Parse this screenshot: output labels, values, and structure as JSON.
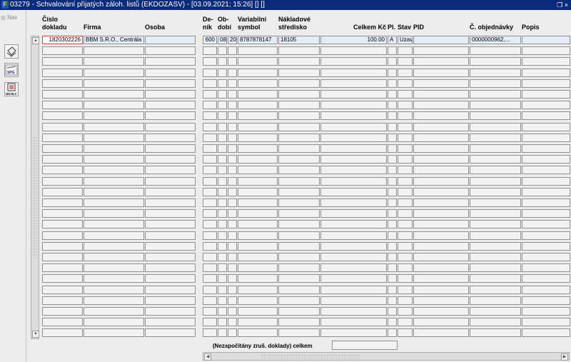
{
  "window": {
    "app_icon": "oracle-forms-icon",
    "title": "03279 - Schvalování přijatých záloh. listů (EKDOZASV) - [03.09.2021; 15:26] [] []",
    "restore_glyph": "❐",
    "close_glyph": "×"
  },
  "nav": {
    "label": "Nav"
  },
  "toolbar": {
    "buttons": [
      {
        "name": "print-icon",
        "label": ""
      },
      {
        "name": "spg-icon",
        "label": "SPG"
      },
      {
        "name": "ukoly-icon",
        "label": "ÚKOLY"
      }
    ]
  },
  "table": {
    "columns": [
      {
        "key": "doklad",
        "label1": "Číslo",
        "label2": "dokladu"
      },
      {
        "key": "firma",
        "label1": "",
        "label2": "Firma"
      },
      {
        "key": "osoba",
        "label1": "",
        "label2": "Osoba"
      },
      {
        "key": "denik",
        "label1": "De-",
        "label2": "ník"
      },
      {
        "key": "obdobi",
        "label1": "Ob-",
        "label2": "dobí"
      },
      {
        "key": "obd2",
        "label1": "",
        "label2": ""
      },
      {
        "key": "vs",
        "label1": "Variabilní",
        "label2": "symbol"
      },
      {
        "key": "stredisko",
        "label1": "Nákladové",
        "label2": "středisko"
      },
      {
        "key": "celkem",
        "label1": "",
        "label2": "Celkem Kč"
      },
      {
        "key": "pl",
        "label1": "",
        "label2": "Pl."
      },
      {
        "key": "stav",
        "label1": "",
        "label2": "Stav"
      },
      {
        "key": "pid",
        "label1": "",
        "label2": "PID"
      },
      {
        "key": "objednavka",
        "label1": "",
        "label2": "Č. objednávky"
      },
      {
        "key": "popis",
        "label1": "",
        "label2": "Popis"
      }
    ],
    "rows": [
      [
        "1820302226",
        "BBM S.R.O., Centrála",
        "",
        "600",
        "08",
        "20",
        "8787878147",
        "18105",
        "100.00",
        "A",
        "Uzav",
        "",
        "0000000962,...",
        ""
      ]
    ],
    "empty_row_count": 27
  },
  "footer": {
    "label": "(Nezapočítány zruš. doklady) celkem",
    "value": ""
  },
  "scroll": {
    "up": "▲",
    "down": "▼",
    "left": "◀",
    "right": "▶"
  }
}
